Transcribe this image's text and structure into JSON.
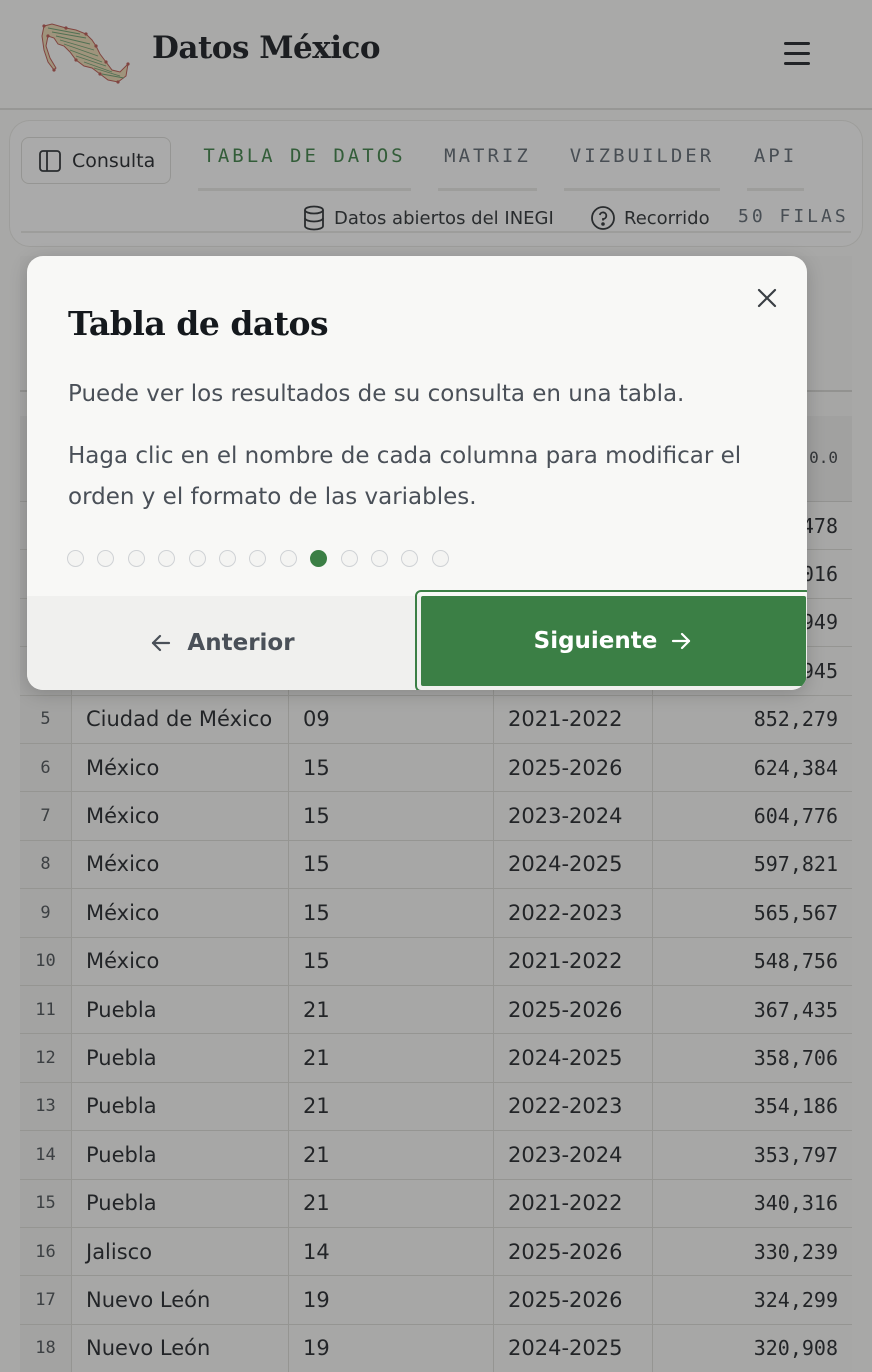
{
  "header": {
    "title": "Datos México"
  },
  "toolbar": {
    "consulta_label": "Consulta",
    "tabs": [
      {
        "label": "TABLA DE DATOS",
        "active": true
      },
      {
        "label": "MATRIZ",
        "active": false
      },
      {
        "label": "VIZBUILDER",
        "active": false
      },
      {
        "label": "API",
        "active": false
      }
    ],
    "source_label": "Datos abiertos del INEGI",
    "tour_label": "Recorrido",
    "rows_label": "50 FILAS"
  },
  "table": {
    "partial_header_value": "0.0",
    "partial_values": [
      "478",
      "016",
      "949",
      "945"
    ],
    "rows": [
      {
        "index": "5",
        "estado": "Ciudad de México",
        "clave": "09",
        "ciclo": "2021-2022",
        "valor": "852,279"
      },
      {
        "index": "6",
        "estado": "México",
        "clave": "15",
        "ciclo": "2025-2026",
        "valor": "624,384"
      },
      {
        "index": "7",
        "estado": "México",
        "clave": "15",
        "ciclo": "2023-2024",
        "valor": "604,776"
      },
      {
        "index": "8",
        "estado": "México",
        "clave": "15",
        "ciclo": "2024-2025",
        "valor": "597,821"
      },
      {
        "index": "9",
        "estado": "México",
        "clave": "15",
        "ciclo": "2022-2023",
        "valor": "565,567"
      },
      {
        "index": "10",
        "estado": "México",
        "clave": "15",
        "ciclo": "2021-2022",
        "valor": "548,756"
      },
      {
        "index": "11",
        "estado": "Puebla",
        "clave": "21",
        "ciclo": "2025-2026",
        "valor": "367,435"
      },
      {
        "index": "12",
        "estado": "Puebla",
        "clave": "21",
        "ciclo": "2024-2025",
        "valor": "358,706"
      },
      {
        "index": "13",
        "estado": "Puebla",
        "clave": "21",
        "ciclo": "2022-2023",
        "valor": "354,186"
      },
      {
        "index": "14",
        "estado": "Puebla",
        "clave": "21",
        "ciclo": "2023-2024",
        "valor": "353,797"
      },
      {
        "index": "15",
        "estado": "Puebla",
        "clave": "21",
        "ciclo": "2021-2022",
        "valor": "340,316"
      },
      {
        "index": "16",
        "estado": "Jalisco",
        "clave": "14",
        "ciclo": "2025-2026",
        "valor": "330,239"
      },
      {
        "index": "17",
        "estado": "Nuevo León",
        "clave": "19",
        "ciclo": "2025-2026",
        "valor": "324,299"
      },
      {
        "index": "18",
        "estado": "Nuevo León",
        "clave": "19",
        "ciclo": "2024-2025",
        "valor": "320,908"
      }
    ]
  },
  "tour_modal": {
    "title": "Tabla de datos",
    "paragraph_1": "Puede ver los resultados de su consulta en una tabla.",
    "paragraph_2": "Haga clic en el nombre de cada columna para modificar el orden y el formato de las variables.",
    "step_current": 9,
    "step_total": 13,
    "prev_label": "Anterior",
    "next_label": "Siguiente"
  },
  "colors": {
    "accent": "#3b7f45",
    "overlay": "rgba(40,40,40,0.38)"
  }
}
